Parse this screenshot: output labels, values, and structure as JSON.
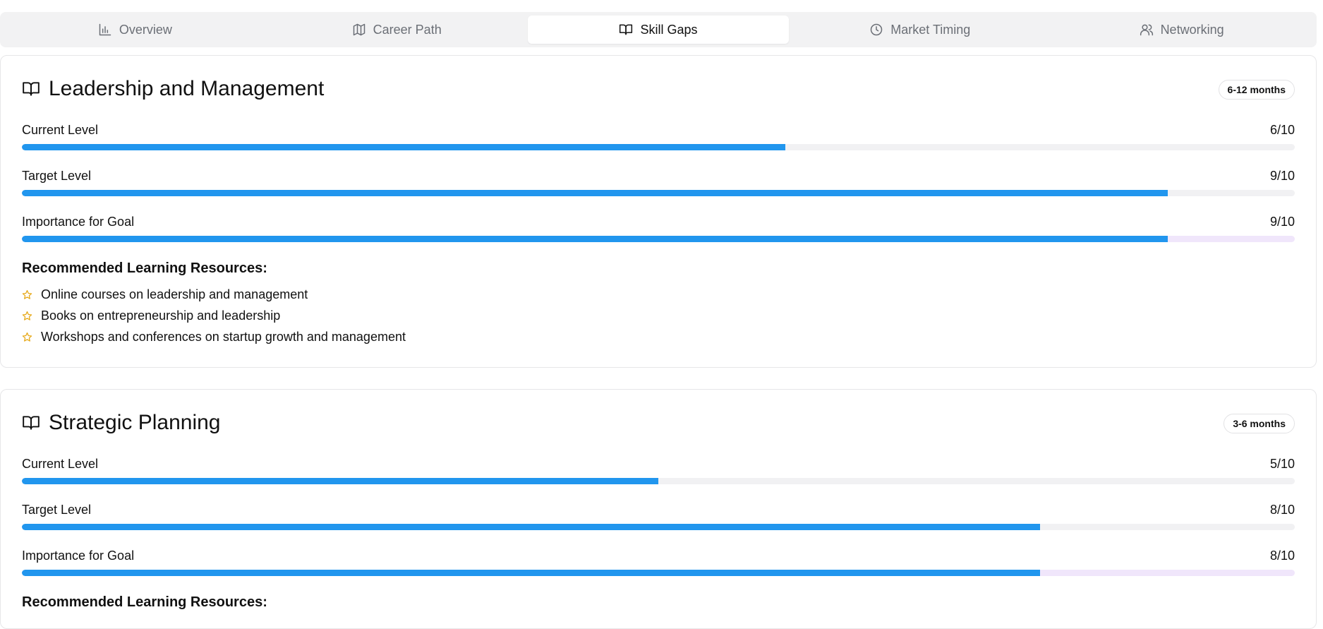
{
  "tabs": [
    {
      "label": "Overview",
      "icon": "bar-chart-icon",
      "active": false
    },
    {
      "label": "Career Path",
      "icon": "map-icon",
      "active": false
    },
    {
      "label": "Skill Gaps",
      "icon": "book-open-icon",
      "active": true
    },
    {
      "label": "Market Timing",
      "icon": "clock-icon",
      "active": false
    },
    {
      "label": "Networking",
      "icon": "users-icon",
      "active": false
    }
  ],
  "colors": {
    "accent": "#2196ee",
    "track": "#f1f1f3",
    "importance_track": "#f0e6fb",
    "star": "#e6a817"
  },
  "skills": [
    {
      "title": "Leadership and Management",
      "icon": "book-open-icon",
      "duration": "6-12 months",
      "metrics": [
        {
          "label": "Current Level",
          "value_text": "6/10",
          "value": 6,
          "max": 10
        },
        {
          "label": "Target Level",
          "value_text": "9/10",
          "value": 9,
          "max": 10
        },
        {
          "label": "Importance for Goal",
          "value_text": "9/10",
          "value": 9,
          "max": 10
        }
      ],
      "resources_title": "Recommended Learning Resources:",
      "resources": [
        "Online courses on leadership and management",
        "Books on entrepreneurship and leadership",
        "Workshops and conferences on startup growth and management"
      ]
    },
    {
      "title": "Strategic Planning",
      "icon": "book-open-icon",
      "duration": "3-6 months",
      "metrics": [
        {
          "label": "Current Level",
          "value_text": "5/10",
          "value": 5,
          "max": 10
        },
        {
          "label": "Target Level",
          "value_text": "8/10",
          "value": 8,
          "max": 10
        },
        {
          "label": "Importance for Goal",
          "value_text": "8/10",
          "value": 8,
          "max": 10
        }
      ],
      "resources_title": "Recommended Learning Resources:"
    }
  ]
}
